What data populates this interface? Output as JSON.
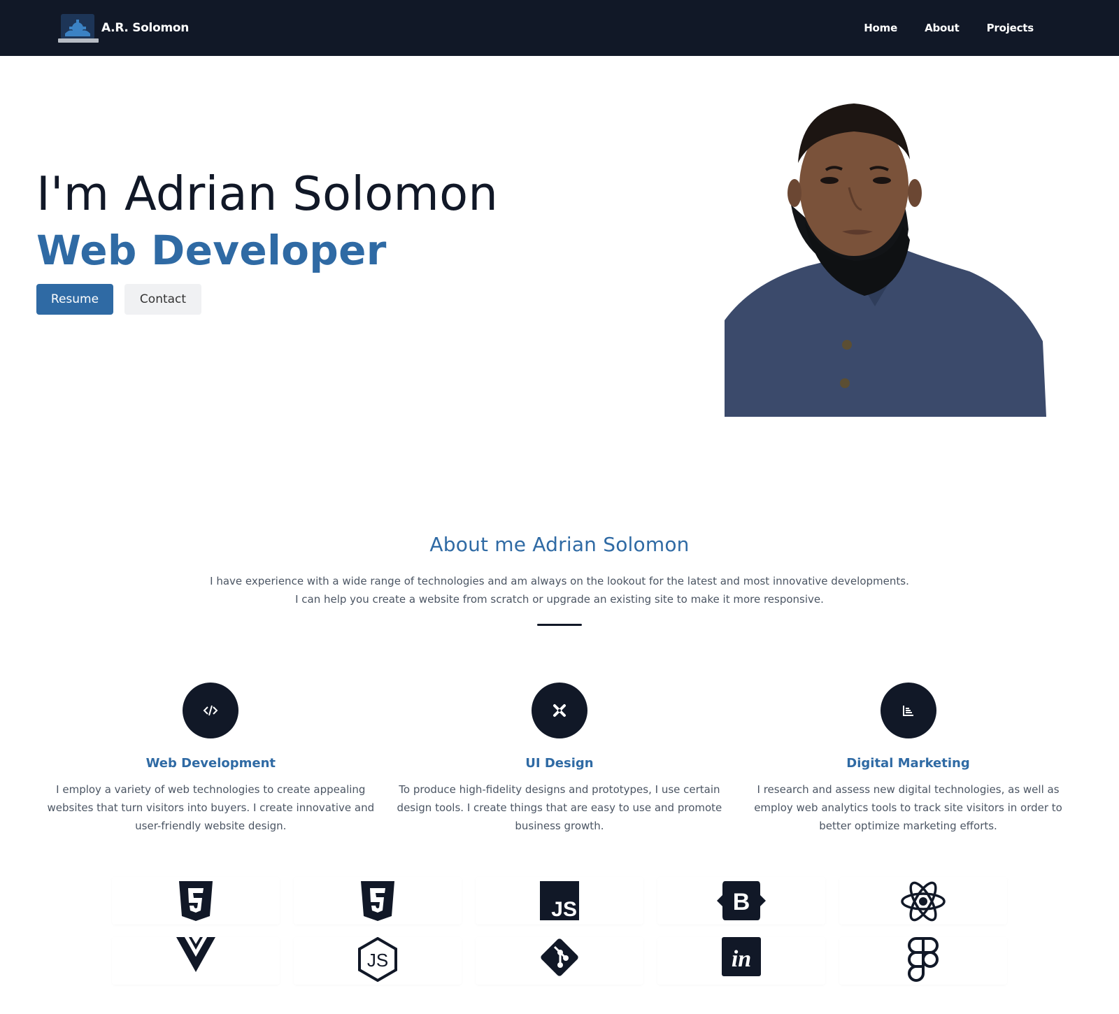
{
  "nav": {
    "brand": "A.R. Solomon",
    "links": [
      "Home",
      "About",
      "Projects"
    ]
  },
  "hero": {
    "title": "I'm Adrian Solomon",
    "subtitle": "Web Developer",
    "buttons": {
      "primary": "Resume",
      "secondary": "Contact"
    }
  },
  "about": {
    "title": "About me Adrian Solomon",
    "text": "I have experience with a wide range of technologies and am always on the lookout for the latest and most innovative developments. I can help you create a website from scratch or upgrade an existing site to make it more responsive."
  },
  "services": [
    {
      "icon": "code-icon",
      "title": "Web Development",
      "text": "I employ a variety of web technologies to create appealing websites that turn visitors into buyers. I create innovative and user-friendly website design."
    },
    {
      "icon": "design-tools-icon",
      "title": "UI Design",
      "text": "To produce high-fidelity designs and prototypes, I use certain design tools. I create things that are easy to use and promote business growth."
    },
    {
      "icon": "chart-icon",
      "title": "Digital Marketing",
      "text": "I research and assess new digital technologies, as well as employ web analytics tools to track site visitors in order to better optimize marketing efforts."
    }
  ],
  "tech": {
    "row1": [
      "html5-icon",
      "css3-icon",
      "javascript-icon",
      "bootstrap-icon",
      "react-icon"
    ],
    "row2": [
      "vue-icon",
      "nodejs-icon",
      "git-icon",
      "invision-icon",
      "figma-icon"
    ]
  },
  "colors": {
    "navbar": "#111827",
    "accent": "#2f6aa4",
    "text": "#111827",
    "muted": "#4b5563"
  }
}
